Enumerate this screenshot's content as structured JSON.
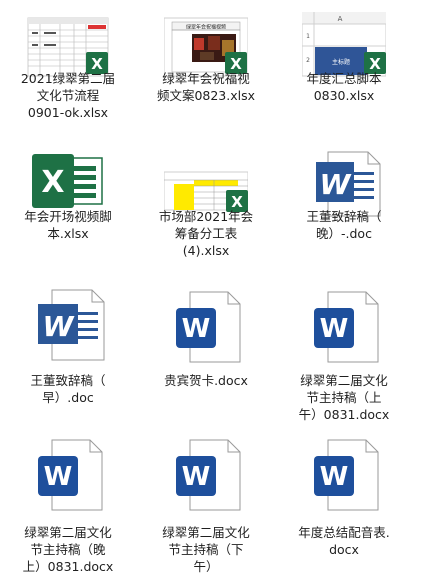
{
  "files": [
    {
      "lines": [
        "2021绿翠第二届",
        "文化节流程",
        "0901-ok.xlsx"
      ],
      "type": "xlsx-thumb-table"
    },
    {
      "lines": [
        "绿翠年会祝福视",
        "频文案0823.xlsx"
      ],
      "type": "xlsx-thumb-photo",
      "thumb_title": "绿翠年会祝福视频"
    },
    {
      "lines": [
        "年度汇总脚本",
        "0830.xlsx"
      ],
      "type": "xlsx-thumb-grid",
      "thumb_col": "A",
      "thumb_rows": [
        "1",
        "2"
      ],
      "thumb_cell": "主标题"
    },
    {
      "lines": [
        "年会开场视频脚",
        "本.xlsx"
      ],
      "type": "xlsx-icon"
    },
    {
      "lines": [
        "市场部2021年会",
        "筹备分工表",
        "(4).xlsx"
      ],
      "type": "xlsx-thumb-yellow"
    },
    {
      "lines": [
        "王董致辞稿（",
        "晚）-.doc"
      ],
      "type": "doc"
    },
    {
      "lines": [
        "王董致辞稿（",
        "早）.doc"
      ],
      "type": "doc"
    },
    {
      "lines": [
        "贵宾贺卡.docx"
      ],
      "type": "docx"
    },
    {
      "lines": [
        "绿翠第二届文化",
        "节主持稿（上",
        "午）0831.docx"
      ],
      "type": "docx"
    },
    {
      "lines": [
        "绿翠第二届文化",
        "节主持稿（晚",
        "上）0831.docx"
      ],
      "type": "docx"
    },
    {
      "lines": [
        "绿翠第二届文化",
        "节主持稿（下",
        "午）"
      ],
      "type": "docx"
    },
    {
      "lines": [
        "年度总结配音表.",
        "docx"
      ],
      "type": "docx"
    }
  ],
  "colors": {
    "excel_green": "#1e7145",
    "word_blue": "#2b5797",
    "word_dark": "#1e4f9c"
  }
}
